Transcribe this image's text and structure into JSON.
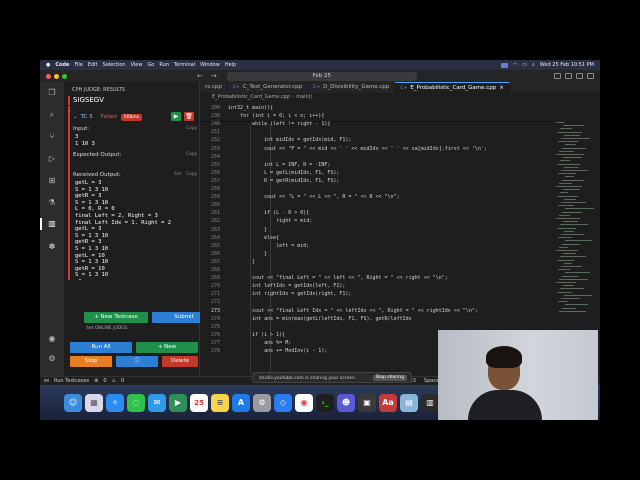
{
  "menubar": {
    "app": "Code",
    "items": [
      "File",
      "Edit",
      "Selection",
      "View",
      "Go",
      "Run",
      "Terminal",
      "Window",
      "Help"
    ],
    "clock": "Wed 25 Feb 10:51 PM"
  },
  "titlebar": {
    "search": "Feb 25"
  },
  "sidebar": {
    "title": "CPH JUDGE: RESULTS",
    "signal": "SIGSEGV",
    "testcase": {
      "name": "TC 5",
      "status": "Failed",
      "time": "566ms",
      "input_label": "Input:",
      "input": "3\n1 10 3",
      "expected_label": "Expected Output:",
      "received_label": "Received Output:",
      "received": "getL = 3\nS = 1 3 10\ngetR = 3\nS = 1 3 10\nL = 0, R = 0\nfinal Left = 2, Right = 3\nfinal Left Idx = 1, Right = 2\ngetL = 3\nS = 1 3 10\ngetR = 3\nS = 1 3 10\ngetL = 10\nS = 1 3 10\ngetR = 10\nS = 1 3 10\n-2",
      "copy": "Copy",
      "set": "Set"
    },
    "buttons": {
      "new_testcase": "+ New Testcase",
      "submit": "Submit",
      "online_judge": "Set ONLINE JUDGE",
      "run_all": "Run All",
      "new": "+ New",
      "stop": "Stop",
      "delete": "Delete"
    }
  },
  "tabs": [
    {
      "label": "rs.cpp",
      "active": false
    },
    {
      "label": "C_Test_Generator.cpp",
      "active": false
    },
    {
      "label": "D_Divisibility_Game.cpp",
      "active": false
    },
    {
      "label": "E_Probabilistic_Card_Game.cpp",
      "active": true
    }
  ],
  "breadcrumb": [
    "E_Probabilistic_Card_Game.cpp",
    "main()"
  ],
  "editor": {
    "lines": [
      {
        "n": "200",
        "t": "int32_t main(){"
      },
      {
        "n": "238",
        "t": "    for (int i = 0; i < n; i++){"
      },
      {
        "n": "248",
        "t": "        while (left != right - 1){"
      },
      {
        "n": "251",
        "t": ""
      },
      {
        "n": "252",
        "t": "            int midIdx = getIdx(mid, F1);"
      },
      {
        "n": "253",
        "t": "            cout << \"F = \" << mid << ' ' << midIdx << ' ' << sa[midIdx].first << '\\n';"
      },
      {
        "n": "254",
        "t": ""
      },
      {
        "n": "255",
        "t": "            int L = INF, R = -INF;"
      },
      {
        "n": "256",
        "t": "            L = getL(midIdx, F1, FS);"
      },
      {
        "n": "257",
        "t": "            R = getR(midIdx, F1, FS);"
      },
      {
        "n": "258",
        "t": ""
      },
      {
        "n": "259",
        "t": "            cout << \"L = \" << L << \", R = \" << R << \"\\n\";"
      },
      {
        "n": "260",
        "t": ""
      },
      {
        "n": "261",
        "t": "            if (L - R > 0){"
      },
      {
        "n": "262",
        "t": "                right = mid;"
      },
      {
        "n": "263",
        "t": "            }"
      },
      {
        "n": "264",
        "t": "            else{"
      },
      {
        "n": "265",
        "t": "                left = mid;"
      },
      {
        "n": "266",
        "t": "            }"
      },
      {
        "n": "267",
        "t": "        }"
      },
      {
        "n": "268",
        "t": ""
      },
      {
        "n": "269",
        "t": "        cout << \"final Left = \" << left << \", Right = \" << right << \"\\n\";"
      },
      {
        "n": "270",
        "t": "        int leftIdx = getIdx(left, F1);"
      },
      {
        "n": "271",
        "t": "        int rightIdx = getIdx(right, F1);"
      },
      {
        "n": "272",
        "t": ""
      },
      {
        "n": "273",
        "t": "        cout << \"final Left Idx = \" << leftIdx << \", Right = \" << rightIdx << \"\\n\";"
      },
      {
        "n": "274",
        "t": "        int ans = min(max(getL(leftIdx, F1, FS), getR(leftIdx"
      },
      {
        "n": "275",
        "t": ""
      },
      {
        "n": "276",
        "t": "        if (i > 1){"
      },
      {
        "n": "277",
        "t": "            ans %= M;"
      },
      {
        "n": "278",
        "t": "            ans += ModInv(i - 1);"
      }
    ],
    "current_line": "273"
  },
  "statusbar": {
    "run_testcases": "Run Testcases",
    "errors": "0",
    "warnings": "0",
    "col": "Col 33",
    "spaces": "Spaces:"
  },
  "sharing": {
    "text": "studio.youtube.com is sharing your screen.",
    "stop": "Stop sharing"
  },
  "dock": {
    "calendar_day": "25"
  }
}
